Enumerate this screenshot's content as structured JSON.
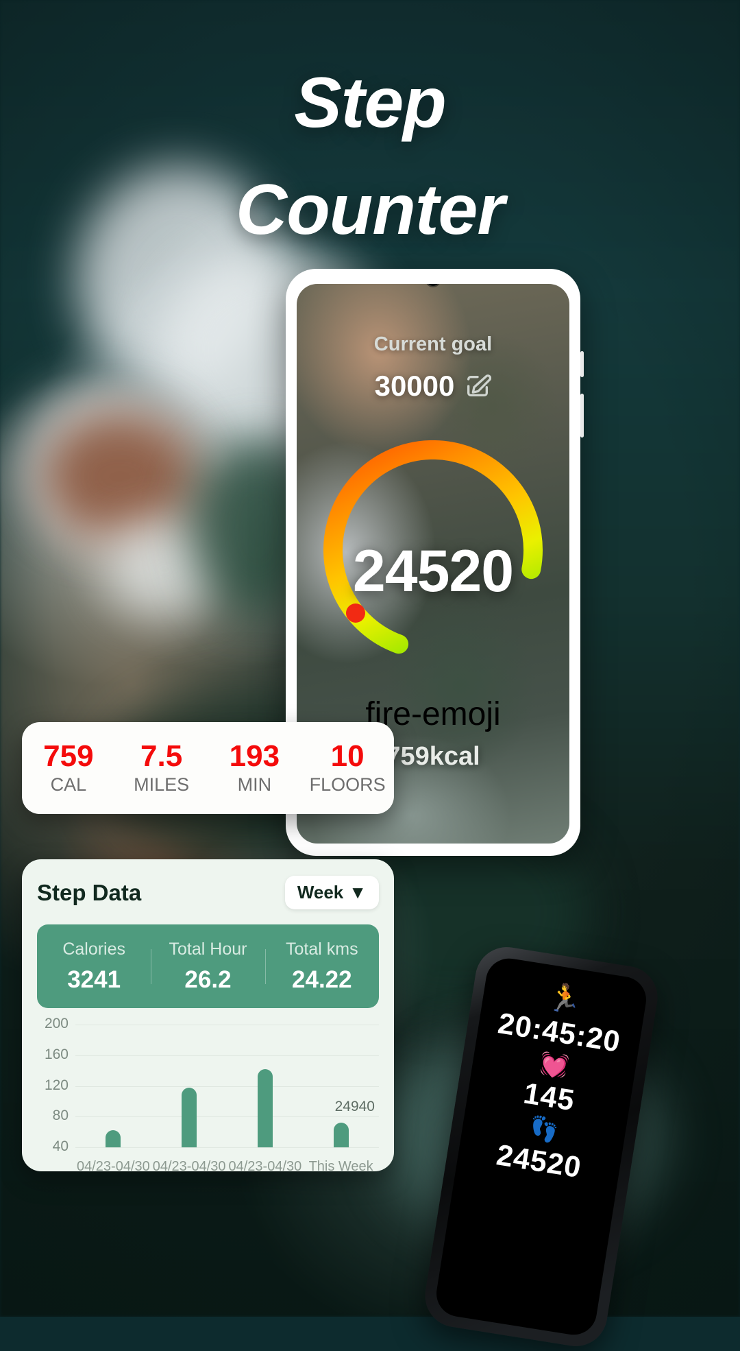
{
  "title": {
    "line1": "Step",
    "line2": "Counter"
  },
  "phone": {
    "goal_label": "Current goal",
    "goal_value": "30000",
    "edit_icon": "edit-square-icon",
    "steps": "24520",
    "fire_icon": "fire-emoji",
    "calories_text": "759kcal"
  },
  "stats": {
    "items": [
      {
        "value": "759",
        "label": "CAL"
      },
      {
        "value": "7.5",
        "label": "MILES"
      },
      {
        "value": "193",
        "label": "MIN"
      },
      {
        "value": "10",
        "label": "FLOORS"
      }
    ]
  },
  "step_data": {
    "title": "Step Data",
    "range_selector": {
      "label": "Week",
      "caret": "▼"
    },
    "summary": [
      {
        "header": "Calories",
        "value": "3241"
      },
      {
        "header": "Total Hour",
        "value": "26.2"
      },
      {
        "header": "Total kms",
        "value": "24.22"
      }
    ],
    "annotation": "24940"
  },
  "watch": {
    "run_icon": "🏃",
    "duration": "20:45:20",
    "heart_icon": "❤",
    "heart_rate": "145",
    "steps_icon": "👣",
    "steps": "24520"
  },
  "colors": {
    "accent_red": "#f40b0b",
    "green": "#4e9b7e",
    "dark_green": "#11291f",
    "gauge_start": "#ff7a00",
    "gauge_mid": "#f2e500",
    "gauge_end": "#3ddc1f"
  },
  "chart_data": {
    "type": "bar",
    "title": "Step Data",
    "categories": [
      "04/23-04/30",
      "04/23-04/30",
      "04/23-04/30",
      "This Week"
    ],
    "values": [
      62,
      118,
      142,
      72
    ],
    "ylabel": "",
    "xlabel": "",
    "yticks": [
      40,
      80,
      120,
      160,
      200
    ],
    "ylim": [
      40,
      200
    ],
    "grid": true,
    "legend": "none",
    "annotations": [
      {
        "text": "24940",
        "category": "This Week"
      }
    ],
    "bar_color": "#4e9b7e"
  }
}
